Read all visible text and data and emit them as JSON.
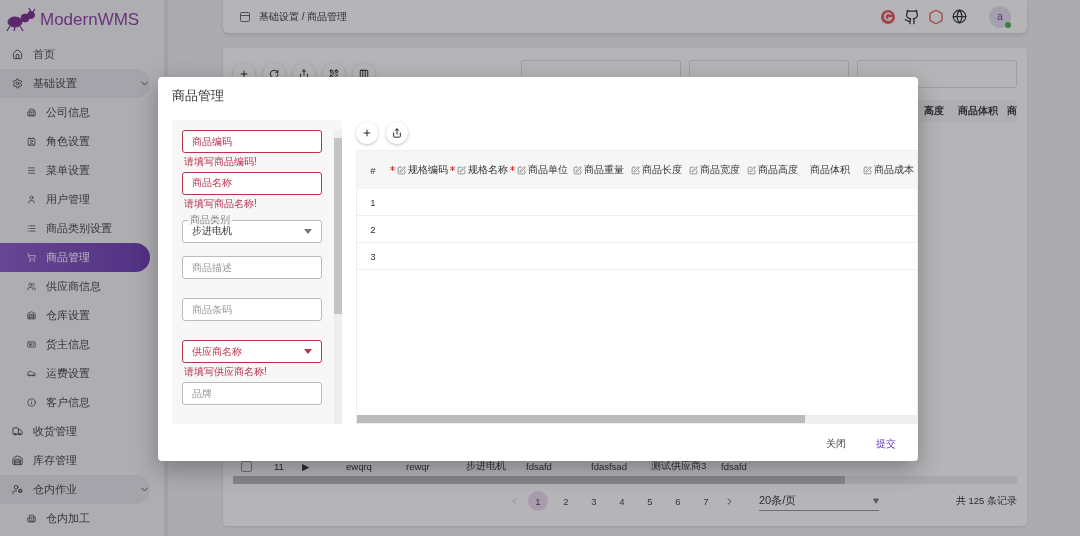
{
  "logo": {
    "text": "ModernWMS"
  },
  "sidebar": {
    "items": [
      {
        "label": "首页",
        "selected": false
      },
      {
        "label": "基础设置",
        "selected": false,
        "expanded": true,
        "children": [
          {
            "label": "公司信息",
            "selected": false
          },
          {
            "label": "角色设置",
            "selected": false
          },
          {
            "label": "菜单设置",
            "selected": false
          },
          {
            "label": "用户管理",
            "selected": false
          },
          {
            "label": "商品类别设置",
            "selected": false
          },
          {
            "label": "商品管理",
            "selected": true
          },
          {
            "label": "供应商信息",
            "selected": false
          },
          {
            "label": "仓库设置",
            "selected": false
          },
          {
            "label": "货主信息",
            "selected": false
          },
          {
            "label": "运费设置",
            "selected": false
          },
          {
            "label": "客户信息",
            "selected": false
          }
        ]
      },
      {
        "label": "收货管理",
        "selected": false
      },
      {
        "label": "库存管理",
        "selected": false
      },
      {
        "label": "仓内作业",
        "selected": false,
        "expanded": true,
        "children": [
          {
            "label": "仓内加工",
            "selected": false
          }
        ]
      }
    ]
  },
  "header": {
    "breadcrumb": [
      "基础设置",
      "商品管理"
    ],
    "separator": "/",
    "avatar": {
      "text": "a",
      "online": true
    }
  },
  "page": {
    "table": {
      "visible_columns": [
        "高度",
        "商品体积",
        "商"
      ],
      "row": {
        "index": "11",
        "expander": "▶",
        "checked": false,
        "cells": [
          "ewqrq",
          "rewqr",
          "步进电机",
          "fdsafd",
          "fdasfsad",
          "测试供应商3",
          "fdsafd"
        ]
      }
    },
    "pagination": {
      "pages": [
        {
          "label": "1",
          "selected": true
        },
        {
          "label": "2",
          "selected": false
        },
        {
          "label": "3",
          "selected": false
        },
        {
          "label": "4",
          "selected": false
        },
        {
          "label": "5",
          "selected": false
        },
        {
          "label": "6",
          "selected": false
        },
        {
          "label": "7",
          "selected": false
        }
      ],
      "page_size": "20条/页",
      "total": "共 125 条记录"
    }
  },
  "dialog": {
    "title": "商品管理",
    "fields": [
      {
        "kind": "input",
        "placeholder": "商品编码",
        "error": "请填写商品编码!"
      },
      {
        "kind": "input",
        "placeholder": "商品名称",
        "error": "请填写商品名称!"
      },
      {
        "kind": "select",
        "label": "商品类别",
        "value": "步进电机"
      },
      {
        "kind": "input",
        "placeholder": "商品描述"
      },
      {
        "kind": "input",
        "placeholder": "商品条码"
      },
      {
        "kind": "select",
        "placeholder": "供应商名称",
        "error": "请填写供应商名称!"
      },
      {
        "kind": "input",
        "placeholder": "品牌"
      }
    ],
    "table": {
      "columns": [
        {
          "label": "#",
          "required": false,
          "editable": false
        },
        {
          "label": "规格编码",
          "required": true,
          "editable": true
        },
        {
          "label": "规格名称",
          "required": true,
          "editable": true
        },
        {
          "label": "商品单位",
          "required": true,
          "editable": true
        },
        {
          "label": "商品重量",
          "required": false,
          "editable": true
        },
        {
          "label": "商品长度",
          "required": false,
          "editable": true
        },
        {
          "label": "商品宽度",
          "required": false,
          "editable": true
        },
        {
          "label": "商品高度",
          "required": false,
          "editable": true
        },
        {
          "label": "商品体积",
          "required": false,
          "editable": false
        },
        {
          "label": "商品成本",
          "required": false,
          "editable": true
        }
      ],
      "rows": [
        {
          "index": "1"
        },
        {
          "index": "2"
        },
        {
          "index": "3"
        }
      ]
    },
    "buttons": [
      {
        "label": "关闭",
        "kind": "plain"
      },
      {
        "label": "提交",
        "kind": "primary"
      }
    ]
  }
}
